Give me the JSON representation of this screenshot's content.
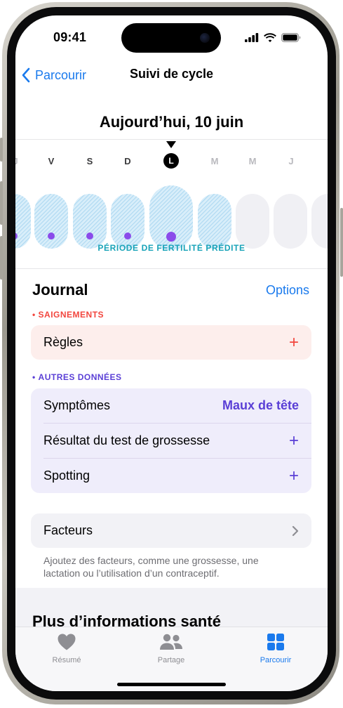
{
  "status": {
    "time": "09:41"
  },
  "nav": {
    "back_label": "Parcourir",
    "title": "Suivi de cycle"
  },
  "calendar": {
    "date_title": "Aujourd’hui, 10 juin",
    "days": [
      {
        "label": "J",
        "today": false
      },
      {
        "label": "V",
        "today": false
      },
      {
        "label": "S",
        "today": false
      },
      {
        "label": "D",
        "today": false
      },
      {
        "label": "L",
        "today": true
      },
      {
        "label": "M",
        "today": false
      },
      {
        "label": "M",
        "today": false
      },
      {
        "label": "J",
        "today": false
      }
    ],
    "fertile_label": "PÉRIODE DE FERTILITÉ PRÉDITE"
  },
  "journal": {
    "title": "Journal",
    "options_label": "Options",
    "bleeding": {
      "section_label": "SAIGNEMENTS",
      "period_label": "Règles",
      "add_glyph": "+"
    },
    "other": {
      "section_label": "AUTRES DONNÉES",
      "symptoms_label": "Symptômes",
      "symptoms_value": "Maux de tête",
      "pregnancy_test_label": "Résultat du test de grossesse",
      "spotting_label": "Spotting",
      "add_glyph": "+"
    },
    "factors": {
      "label": "Facteurs",
      "footnote": "Ajoutez des facteurs, comme une grossesse, une lactation ou l’utilisation d’un contraceptif."
    }
  },
  "more_info": {
    "title": "Plus d’informations santé"
  },
  "tabbar": {
    "tabs": [
      {
        "label": "Résumé",
        "icon": "heart-icon",
        "selected": false
      },
      {
        "label": "Partage",
        "icon": "people-icon",
        "selected": false
      },
      {
        "label": "Parcourir",
        "icon": "grid-icon",
        "selected": true
      }
    ]
  },
  "colors": {
    "accent": "#1a7aed",
    "bleeding": "#f2453d",
    "bleeding_bg": "#fdeeec",
    "other": "#5a3fd6",
    "other_bg": "#efedfb",
    "fertile": "#18a3b8",
    "dot": "#8a4bea"
  }
}
